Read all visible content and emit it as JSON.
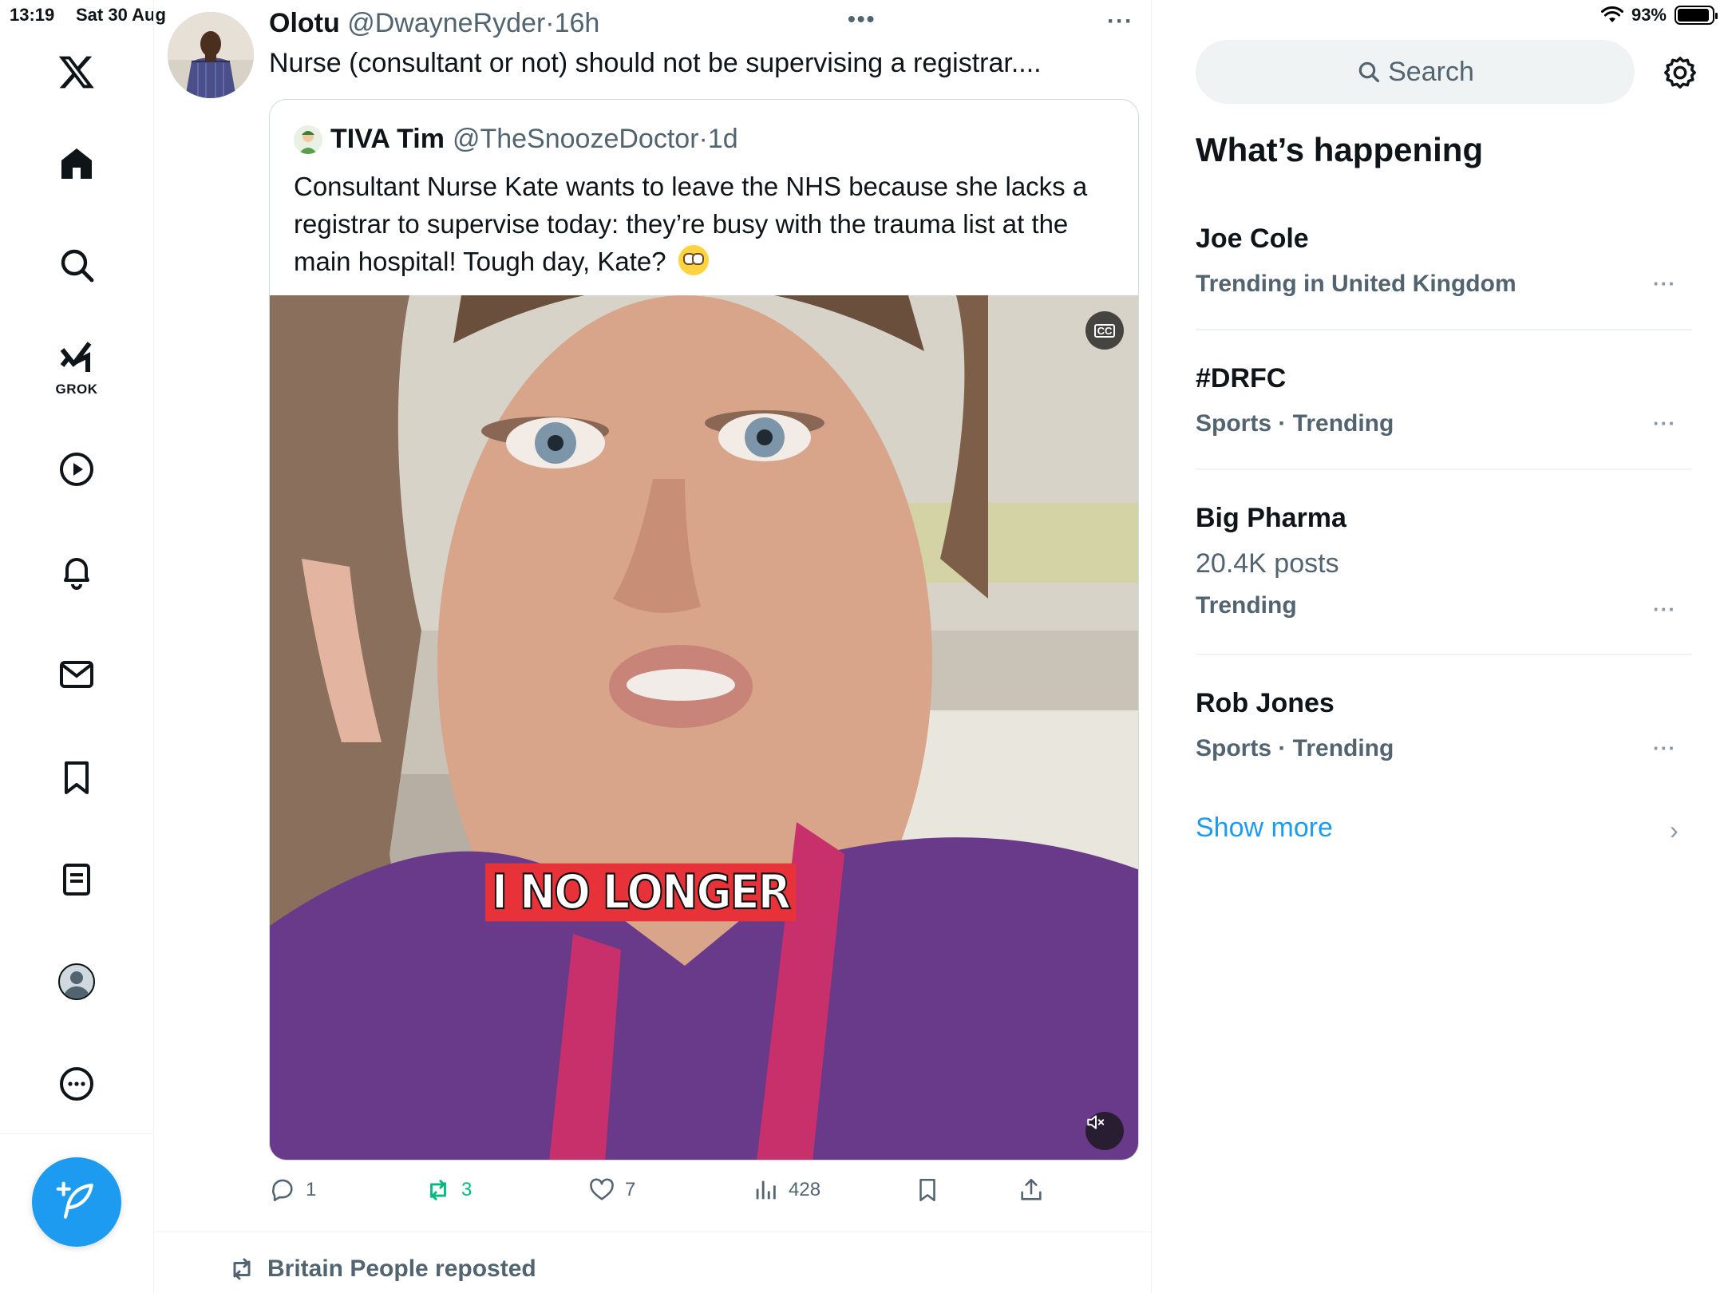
{
  "status_bar": {
    "time": "13:19",
    "date": "Sat 30 Aug",
    "battery": "93%",
    "battery_level": 0.93
  },
  "nav": {
    "items": [
      {
        "icon": "x-logo-icon"
      },
      {
        "icon": "home-icon"
      },
      {
        "icon": "search-icon"
      },
      {
        "icon": "grok-icon",
        "label": "GROK"
      },
      {
        "icon": "video-play-icon"
      },
      {
        "icon": "bell-icon"
      },
      {
        "icon": "mail-icon"
      },
      {
        "icon": "bookmark-icon"
      },
      {
        "icon": "notes-icon"
      },
      {
        "icon": "profile-icon"
      },
      {
        "icon": "more-circle-icon"
      }
    ],
    "compose_icon": "compose-feather-icon"
  },
  "tweet": {
    "name": "Olotu",
    "handle": "@DwayneRyder",
    "dot": "·",
    "time": "16h",
    "text": "Nurse (consultant or not) should not be supervising a registrar....",
    "more": "···",
    "quote": {
      "name": "TIVA Tim",
      "handle": "@TheSnoozeDoctor",
      "dot": "·",
      "time": "1d",
      "text": "Consultant Nurse Kate wants to leave the NHS because she lacks a registrar to supervise today: they’re busy with the trauma list at the main hospital! Tough day, Kate?",
      "video_caption": "I NO LONGER",
      "cc_label": "CC"
    },
    "actions": {
      "replies": "1",
      "reposts": "3",
      "likes": "7",
      "views": "428"
    }
  },
  "next_item": {
    "repost_text": "Britain People reposted"
  },
  "right": {
    "search_placeholder": "Search",
    "section_title": "What’s happening",
    "trends": [
      {
        "title": "Joe Cole",
        "subtitle": "Trending in United Kingdom"
      },
      {
        "title": "#DRFC",
        "subtitle": "Sports · Trending"
      },
      {
        "title": "Big Pharma",
        "count": "20.4K posts",
        "subtitle": "Trending"
      },
      {
        "title": "Rob Jones",
        "subtitle": "Sports · Trending"
      }
    ],
    "more_dots": "···",
    "show_more": "Show more",
    "chevron": "›"
  },
  "colors": {
    "accent": "#1d9bf0",
    "secondary_text": "#536471",
    "repost_green": "#00ba7c"
  }
}
